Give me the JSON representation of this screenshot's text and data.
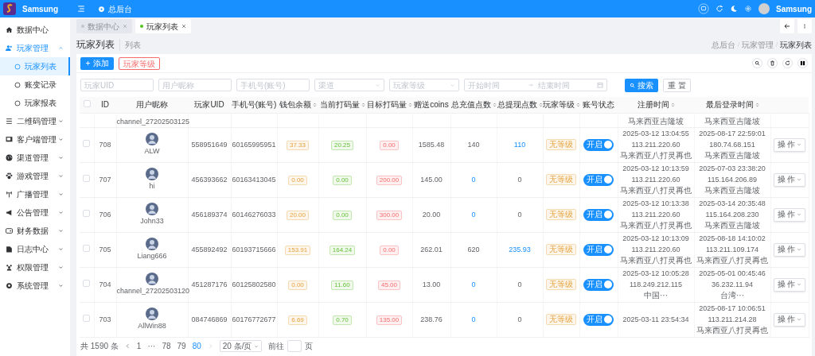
{
  "topbar": {
    "brand": "Samsung",
    "home": "总后台",
    "user": "Samsung"
  },
  "sidebar": {
    "items": [
      {
        "label": "数据中心",
        "selected": false
      },
      {
        "label": "玩家管理",
        "selected": false,
        "expanded": true,
        "children": [
          {
            "label": "玩家列表",
            "selected": true
          },
          {
            "label": "账变记录",
            "selected": false
          },
          {
            "label": "玩家报表",
            "selected": false
          }
        ]
      },
      {
        "label": "二维码管理",
        "selected": false,
        "expanded": false
      },
      {
        "label": "客户端管理",
        "selected": false,
        "expanded": false
      },
      {
        "label": "渠道管理",
        "selected": false,
        "expanded": false
      },
      {
        "label": "游戏管理",
        "selected": false,
        "expanded": false
      },
      {
        "label": "广播管理",
        "selected": false,
        "expanded": false
      },
      {
        "label": "公告管理",
        "selected": false,
        "expanded": false
      },
      {
        "label": "财务数据",
        "selected": false,
        "expanded": false
      },
      {
        "label": "日志中心",
        "selected": false,
        "expanded": false
      },
      {
        "label": "权限管理",
        "selected": false,
        "expanded": false
      },
      {
        "label": "系统管理",
        "selected": false,
        "expanded": false
      }
    ]
  },
  "tabs": [
    {
      "label": "数据中心",
      "selected": false
    },
    {
      "label": "玩家列表",
      "selected": true
    }
  ],
  "page": {
    "title": "玩家列表",
    "subtitle": "列表",
    "breadcrumb": [
      "总后台",
      "玩家管理",
      "玩家列表"
    ]
  },
  "toolbar": {
    "add": "添加",
    "levels": "玩家等级"
  },
  "filters": [
    {
      "kind": "input",
      "placeholder": "玩家UID"
    },
    {
      "kind": "input",
      "placeholder": "用户昵称"
    },
    {
      "kind": "input",
      "placeholder": "手机号(账号)"
    },
    {
      "kind": "select",
      "placeholder": "渠道"
    },
    {
      "kind": "select",
      "placeholder": "玩家等级"
    }
  ],
  "date_range": {
    "start": "开始时间",
    "end": "结束时间"
  },
  "search": "搜索",
  "reset": "重 置",
  "table": {
    "all_checked": false,
    "columns": [
      {
        "label": "ID",
        "sortable": false
      },
      {
        "label": "用户昵称",
        "sortable": false
      },
      {
        "label": "玩家UID",
        "sortable": false
      },
      {
        "label": "手机号(账号)",
        "sortable": false
      },
      {
        "label": "钱包余额",
        "sortable": true
      },
      {
        "label": "当前打码量",
        "sortable": true
      },
      {
        "label": "目标打码量",
        "sortable": true
      },
      {
        "label": "赠送coins",
        "sortable": false
      },
      {
        "label": "总充值点数",
        "sortable": true
      },
      {
        "label": "总提现点数",
        "sortable": true
      },
      {
        "label": "玩家等级",
        "sortable": true
      },
      {
        "label": "账号状态",
        "sortable": false
      },
      {
        "label": "注册时间",
        "sortable": true
      },
      {
        "label": "最后登录时间",
        "sortable": true
      }
    ],
    "partial_row": {
      "nickname": "channel_27202503125",
      "reg_location": "马来西亚吉隆坡",
      "last_location": "马来西亚吉隆坡"
    },
    "rows": [
      {
        "checked": false,
        "id": "708",
        "nickname": "ALW",
        "uid": "558951649",
        "phone": "60165995951",
        "wallet": "37.33",
        "current_bet": "20.25",
        "target_bet": "0.00",
        "gift_coins": "1585.48",
        "total_recharge": "140",
        "total_withdraw": "110",
        "level": "无等级",
        "enabled": true,
        "status": "开启",
        "reg_time": "2025-03-12 13:04:55",
        "reg_ip": "113.211.220.60",
        "reg_location": "马来西亚八打灵再也",
        "last_time": "2025-08-17 22:59:01",
        "last_ip": "180.74.68.151",
        "last_location": "马来西亚吉隆坡",
        "action": "操 作"
      },
      {
        "checked": false,
        "id": "707",
        "nickname": "hi",
        "uid": "456393662",
        "phone": "60163413045",
        "wallet": "0.00",
        "current_bet": "0.00",
        "target_bet": "200.00",
        "gift_coins": "145.00",
        "total_recharge": "0",
        "total_withdraw": "0",
        "level": "无等级",
        "enabled": true,
        "status": "开启",
        "reg_time": "2025-03-12 10:13:59",
        "reg_ip": "113.211.220.60",
        "reg_location": "马来西亚八打灵再也",
        "last_time": "2025-07-03 23:38:20",
        "last_ip": "115.164.206.89",
        "last_location": "马来西亚吉隆坡",
        "action": "操 作"
      },
      {
        "checked": false,
        "id": "706",
        "nickname": "John33",
        "uid": "456189374",
        "phone": "60146276033",
        "wallet": "20.00",
        "current_bet": "0.00",
        "target_bet": "300.00",
        "gift_coins": "20.00",
        "total_recharge": "0",
        "total_withdraw": "0",
        "level": "无等级",
        "enabled": true,
        "status": "开启",
        "reg_time": "2025-03-12 10:13:38",
        "reg_ip": "113.211.220.60",
        "reg_location": "马来西亚八打灵再也",
        "last_time": "2025-03-14 20:35:48",
        "last_ip": "115.164.208.230",
        "last_location": "马来西亚吉隆坡",
        "action": "操 作"
      },
      {
        "checked": false,
        "id": "705",
        "nickname": "Liang666",
        "uid": "455892492",
        "phone": "60193715666",
        "wallet": "153.91",
        "current_bet": "164.24",
        "target_bet": "0.00",
        "gift_coins": "262.01",
        "total_recharge": "620",
        "total_withdraw": "235.93",
        "level": "无等级",
        "enabled": true,
        "status": "开启",
        "reg_time": "2025-03-12 10:13:09",
        "reg_ip": "113.211.220.60",
        "reg_location": "马来西亚八打灵再也",
        "last_time": "2025-08-18 14:10:02",
        "last_ip": "113.211.109.174",
        "last_location": "马来西亚八打灵再也",
        "action": "操 作"
      },
      {
        "checked": false,
        "id": "704",
        "nickname": "channel_27202503120",
        "uid": "451287176",
        "phone": "60125802580",
        "wallet": "0.00",
        "current_bet": "11.60",
        "target_bet": "45.00",
        "gift_coins": "13.00",
        "total_recharge": "0",
        "total_withdraw": "0",
        "level": "无等级",
        "enabled": true,
        "status": "开启",
        "reg_time": "2025-03-12 10:05:28",
        "reg_ip": "118.249.212.115",
        "reg_location": "中国···",
        "last_time": "2025-05-01 00:45:46",
        "last_ip": "36.232.11.94",
        "last_location": "台湾···",
        "action": "操 作"
      },
      {
        "checked": false,
        "id": "703",
        "nickname": "AllWin88",
        "uid": "084746869",
        "phone": "60176772677",
        "wallet": "6.69",
        "current_bet": "0.70",
        "target_bet": "135.00",
        "gift_coins": "238.76",
        "total_recharge": "0",
        "total_withdraw": "0",
        "level": "无等级",
        "enabled": true,
        "status": "开启",
        "reg_time": "2025-03-11 23:54:34",
        "last_time": "2025-08-17 10:06:51",
        "last_ip": "113.211.214.28",
        "last_location": "马来西亚八打灵再也",
        "action": "操 作"
      }
    ]
  },
  "pagination": {
    "total": "共 1590 条",
    "pages": [
      {
        "label": "1",
        "selected": false
      },
      {
        "label": "···",
        "selected": false
      },
      {
        "label": "78",
        "selected": false
      },
      {
        "label": "79",
        "selected": false
      },
      {
        "label": "80",
        "selected": true
      }
    ],
    "page_size": "20 条/页",
    "goto": "前往",
    "page_unit": "页"
  }
}
